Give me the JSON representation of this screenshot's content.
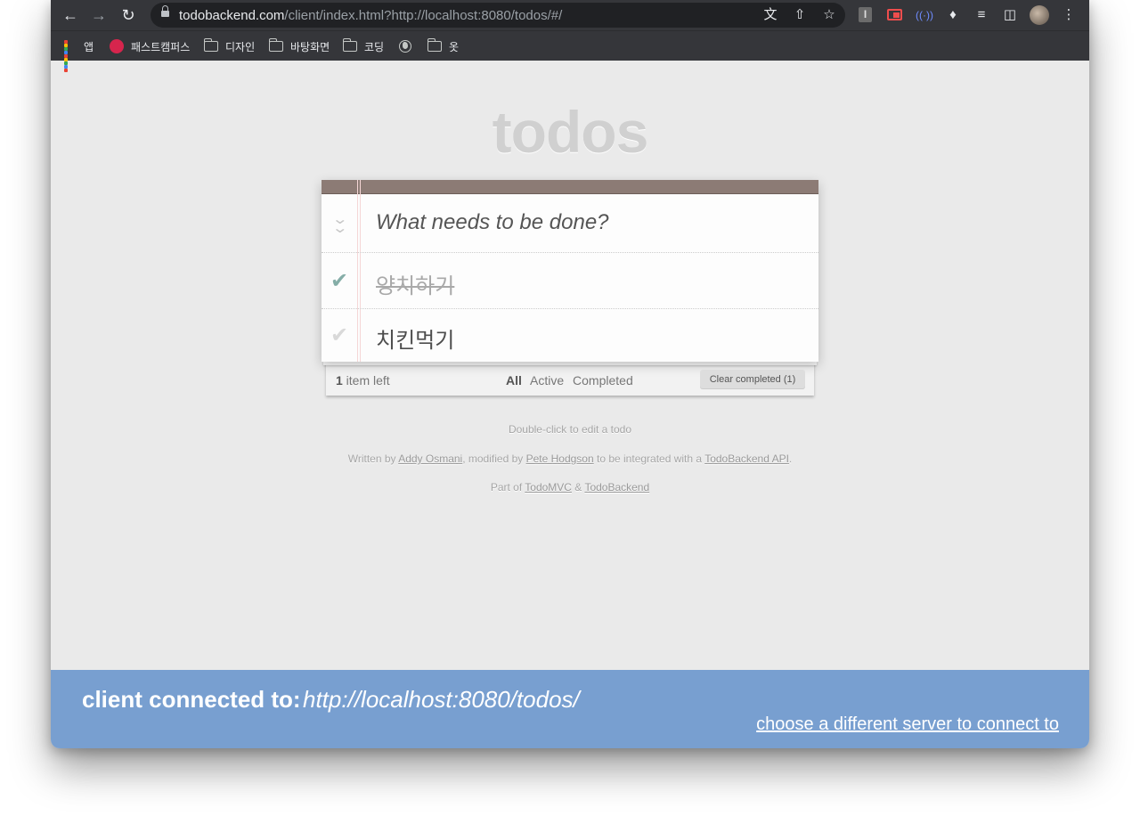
{
  "browser": {
    "url_host": "todobackend.com",
    "url_rest": "/client/index.html?http://localhost:8080/todos/#/",
    "bookmarks": [
      {
        "label": "앱",
        "icon": "apps-grid-icon"
      },
      {
        "label": "패스트캠퍼스",
        "icon": "dribbble-icon"
      },
      {
        "label": "디자인",
        "icon": "folder-icon"
      },
      {
        "label": "바탕화면",
        "icon": "folder-icon"
      },
      {
        "label": "코딩",
        "icon": "folder-icon"
      },
      {
        "label": "",
        "icon": "globe-icon"
      },
      {
        "label": "옷",
        "icon": "folder-icon"
      }
    ]
  },
  "app": {
    "title": "todos",
    "new_todo_placeholder": "What needs to be done?",
    "todos": [
      {
        "title": "양치하기",
        "completed": true
      },
      {
        "title": "치킨먹기",
        "completed": false
      }
    ],
    "footer": {
      "count": "1",
      "count_suffix": " item left",
      "filters": [
        "All",
        "Active",
        "Completed"
      ],
      "selected_filter": "All",
      "clear_label": "Clear completed (1)"
    },
    "info": {
      "edit_hint": "Double-click to edit a todo",
      "written_by": "Written by ",
      "author1": "Addy Osmani",
      "modified_by": ", modified by ",
      "author2": "Pete Hodgson",
      "integrated": " to be integrated with a ",
      "api_link": "TodoBackend API",
      "period": ".",
      "part_of": "Part of ",
      "todomvc": "TodoMVC",
      "amp": " & ",
      "todobackend": "TodoBackend"
    }
  },
  "banner": {
    "label": "client connected to:",
    "url": "http://localhost:8080/todos/",
    "change_link": "choose a different server to connect to"
  },
  "colors": {
    "banner_bg": "#789fd0",
    "header_strip": "#8c7b75",
    "check_done": "#85ada7"
  }
}
